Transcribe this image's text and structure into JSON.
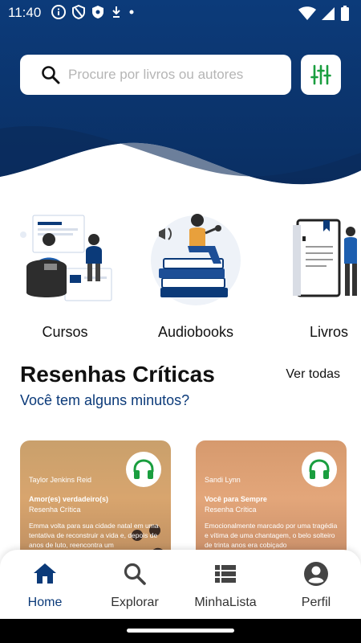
{
  "status_bar": {
    "time": "11:40"
  },
  "search": {
    "placeholder": "Procure por livros ou autores"
  },
  "categories": [
    {
      "label": "Cursos"
    },
    {
      "label": "Audiobooks"
    },
    {
      "label": "Livros"
    }
  ],
  "reviews_section": {
    "title": "Resenhas Críticas",
    "subtitle": "Você tem alguns minutos?",
    "see_all": "Ver todas"
  },
  "review_cards": [
    {
      "author": "Taylor Jenkins Reid",
      "title": "Amor(es) verdadeiro(s)",
      "kind": "Resenha Crítica",
      "text": "Emma volta para sua cidade natal em uma tentativa de reconstruir a vida e, depois de anos de luto, reencontra um"
    },
    {
      "author": "Sandi Lynn",
      "title": "Você para Sempre",
      "kind": "Resenha Crítica",
      "text": "Emocionalmente marcado por uma tragédia e vítima de uma chantagem, o belo solteiro de trinta anos era cobiçado"
    }
  ],
  "bottom_nav": [
    {
      "label": "Home",
      "icon": "home-icon",
      "active": true
    },
    {
      "label": "Explorar",
      "icon": "search-icon",
      "active": false
    },
    {
      "label": "MinhaLista",
      "icon": "list-icon",
      "active": false
    },
    {
      "label": "Perfil",
      "icon": "account-icon",
      "active": false
    }
  ],
  "colors": {
    "primary": "#0b3a79",
    "accent_green": "#1a9e3f",
    "background": "#ffffff"
  }
}
